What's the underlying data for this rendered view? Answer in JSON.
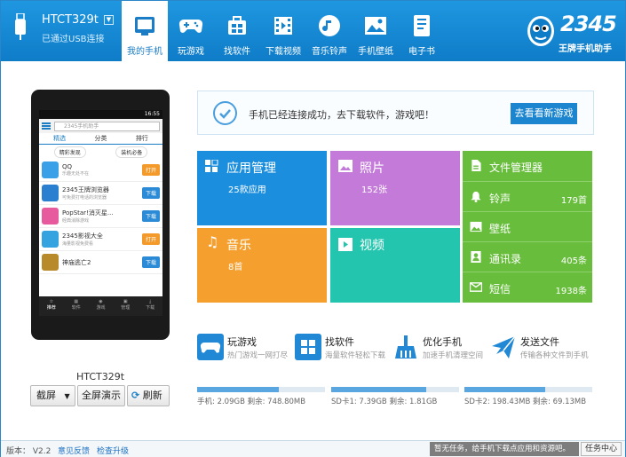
{
  "header": {
    "device_name": "HTCT329t",
    "device_status": "已通过USB连接",
    "dropdown_glyph": "▼",
    "nav": [
      {
        "label": "我的手机",
        "icon": "phone-icon",
        "active": true
      },
      {
        "label": "玩游戏",
        "icon": "gamepad-icon",
        "active": false
      },
      {
        "label": "找软件",
        "icon": "apps-icon",
        "active": false
      },
      {
        "label": "下载视频",
        "icon": "film-icon",
        "active": false
      },
      {
        "label": "音乐铃声",
        "icon": "music-icon",
        "active": false
      },
      {
        "label": "手机壁纸",
        "icon": "wallpaper-icon",
        "active": false
      },
      {
        "label": "电子书",
        "icon": "book-icon",
        "active": false
      }
    ],
    "brand_number": "2345",
    "brand_tagline": "王牌手机助手"
  },
  "phone": {
    "status_time": "16:55",
    "search_placeholder": "2345手机助手",
    "tabs": [
      "精选",
      "分类",
      "排行"
    ],
    "chips": [
      "精彩发现",
      "装机必备"
    ],
    "apps": [
      {
        "name": "QQ",
        "desc": "乐趣无处不在",
        "btn": "打开",
        "btn_color": "#f39a2b",
        "icon_color": "#3aa0e8"
      },
      {
        "name": "2345王牌浏览器",
        "desc": "可免费打电话的浏览器",
        "btn": "下载",
        "btn_color": "#2b8bd6",
        "icon_color": "#2b7fd0"
      },
      {
        "name": "PopStar!消灭星...",
        "desc": "经典消除游戏",
        "btn": "下载",
        "btn_color": "#2b8bd6",
        "icon_color": "#e85a9e"
      },
      {
        "name": "2345影视大全",
        "desc": "海量影视免费看",
        "btn": "打开",
        "btn_color": "#f39a2b",
        "icon_color": "#35a3e0"
      },
      {
        "name": "神庙逃亡2",
        "desc": "",
        "btn": "下载",
        "btn_color": "#2b8bd6",
        "icon_color": "#b88a2a"
      }
    ],
    "bottom_nav": [
      "推荐",
      "软件",
      "游戏",
      "管理",
      "下载"
    ],
    "model": "HTCT329t",
    "screenshot_label": "截屏",
    "screenshot_dd": "▼",
    "fullscreen_label": "全屏演示",
    "refresh_label": "刷新"
  },
  "connect": {
    "message": "手机已经连接成功，去下载软件，游戏吧！",
    "button": "去看看新游戏"
  },
  "tiles": {
    "apps": {
      "title": "应用管理",
      "sub": "25款应用",
      "color": "#1c8ede"
    },
    "photos": {
      "title": "照片",
      "sub": "152张",
      "color": "#c47ad9"
    },
    "music": {
      "title": "音乐",
      "sub": "8首",
      "color": "#f5a02e"
    },
    "video": {
      "title": "视频",
      "color": "#23c5ae"
    },
    "files": {
      "color": "#68be3c",
      "rows": [
        {
          "label": "文件管理器",
          "count": "",
          "icon": "file-icon"
        },
        {
          "label": "铃声",
          "count": "179首",
          "icon": "bell-icon"
        },
        {
          "label": "壁纸",
          "count": "",
          "icon": "wallpaper-small-icon"
        },
        {
          "label": "通讯录",
          "count": "405条",
          "icon": "contacts-icon"
        },
        {
          "label": "短信",
          "count": "1938条",
          "icon": "mail-icon"
        }
      ]
    }
  },
  "tools": [
    {
      "title": "玩游戏",
      "sub": "热门游戏一网打尽",
      "icon": "game-tool-icon"
    },
    {
      "title": "找软件",
      "sub": "海量软件轻松下载",
      "icon": "software-tool-icon"
    },
    {
      "title": "优化手机",
      "sub": "加速手机清理空间",
      "icon": "broom-icon"
    },
    {
      "title": "发送文件",
      "sub": "传输各种文件到手机",
      "icon": "send-icon"
    }
  ],
  "storage": [
    {
      "label": "手机: 2.09GB  剩余: 748.80MB",
      "used_fraction": 0.64
    },
    {
      "label": "SD卡1: 7.39GB  剩余: 1.81GB",
      "used_fraction": 0.74
    },
    {
      "label": "SD卡2: 198.43MB  剩余: 69.13MB",
      "used_fraction": 0.63
    }
  ],
  "status_bar": {
    "version": "版本： V2.2",
    "feedback": "意见反馈",
    "check_update": "检查升级",
    "task_message": "暂无任务，给手机下载点应用和资源吧。",
    "task_center": "任务中心"
  }
}
